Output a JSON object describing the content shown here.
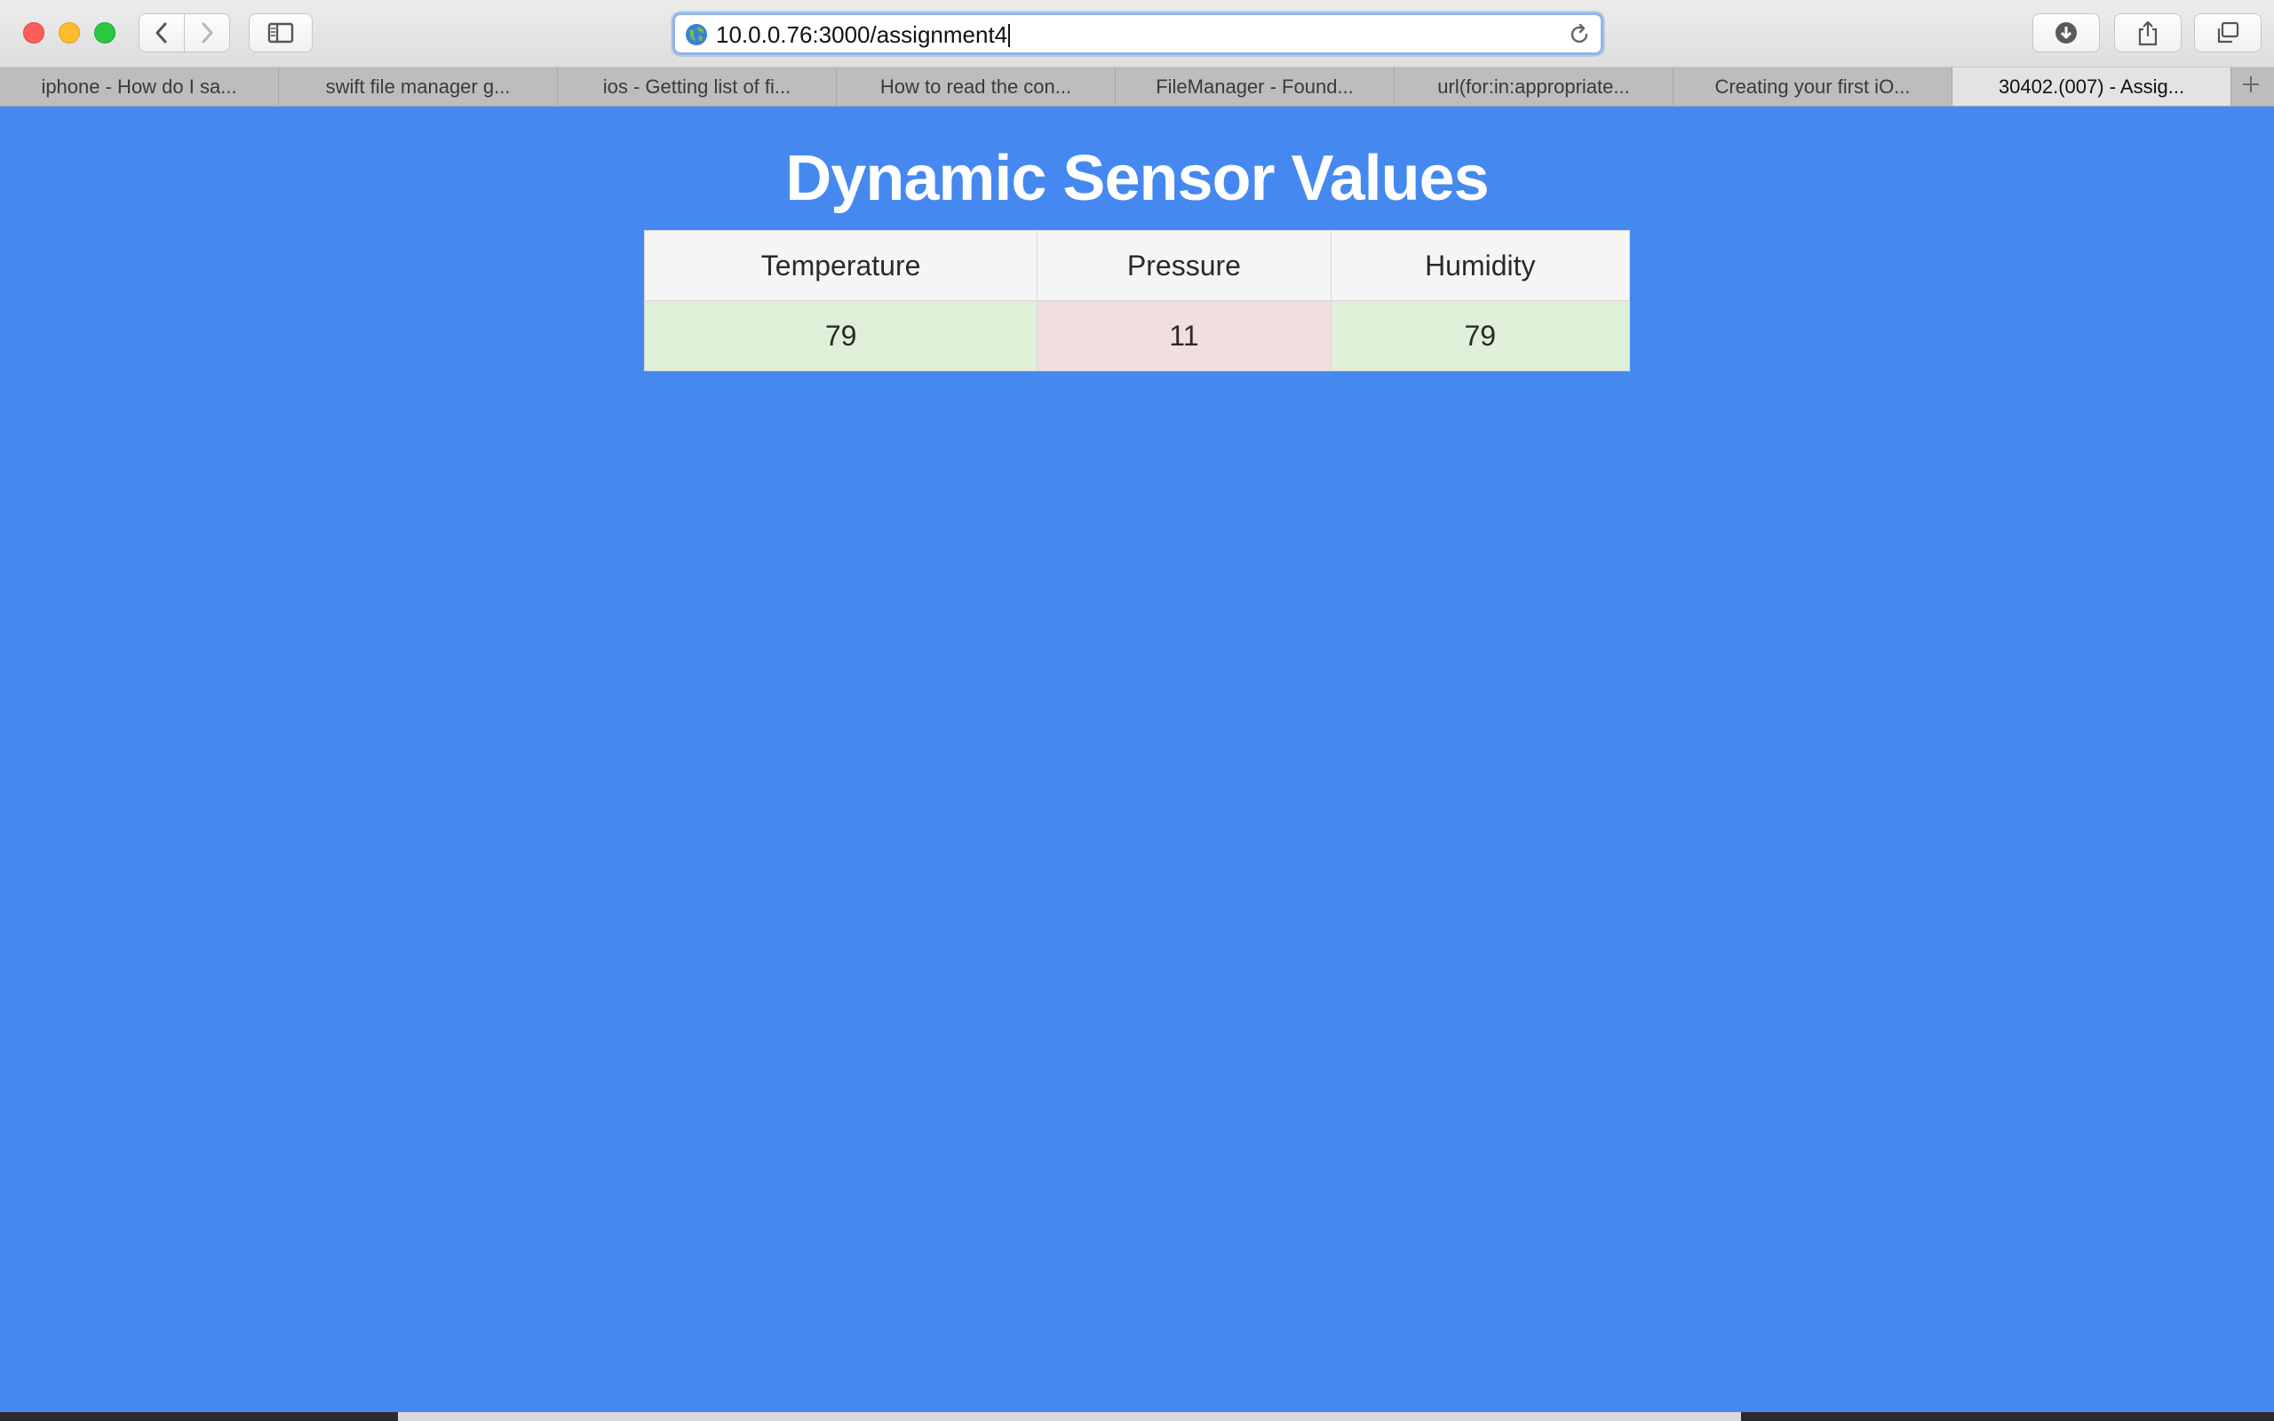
{
  "browser": {
    "url": "10.0.0.76:3000/assignment4",
    "tabs": [
      {
        "label": "iphone - How do I sa...",
        "active": false
      },
      {
        "label": "swift file manager g...",
        "active": false
      },
      {
        "label": "ios - Getting list of fi...",
        "active": false
      },
      {
        "label": "How to read the con...",
        "active": false
      },
      {
        "label": "FileManager - Found...",
        "active": false
      },
      {
        "label": "url(for:in:appropriate...",
        "active": false
      },
      {
        "label": "Creating your first iO...",
        "active": false
      },
      {
        "label": "30402.(007) - Assig...",
        "active": true
      }
    ],
    "icons": {
      "back": "chevron-left-icon",
      "forward": "chevron-right-icon",
      "sidebar": "sidebar-icon",
      "site": "globe-icon",
      "reload": "reload-icon",
      "downloads": "download-icon",
      "share": "share-icon",
      "tabs": "tabs-overview-icon",
      "new_tab": "plus-icon"
    }
  },
  "page": {
    "title": "Dynamic Sensor Values",
    "background_color": "#4589f0",
    "table": {
      "headers": [
        "Temperature",
        "Pressure",
        "Humidity"
      ],
      "values": [
        "79",
        "11",
        "79"
      ],
      "status": [
        "ok",
        "bad",
        "ok"
      ],
      "status_colors": {
        "ok": "#dff0d8",
        "bad": "#f2dede"
      }
    }
  }
}
